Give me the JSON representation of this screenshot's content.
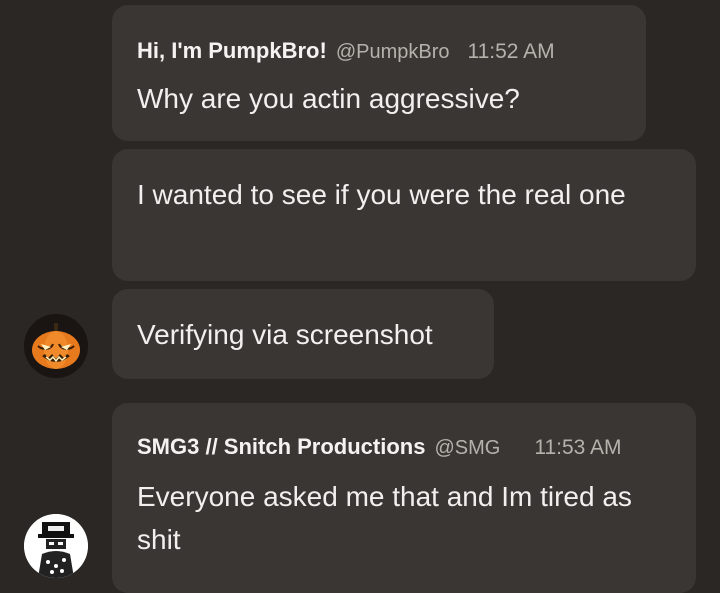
{
  "messages": [
    {
      "author": "Hi, I'm PumpkBro!",
      "handle": "@PumpkBro",
      "time": "11:52 AM",
      "text": "Why are you actin aggressive?"
    },
    {
      "text": "I wanted to see if you were the real one"
    },
    {
      "text": "Verifying via screenshot"
    },
    {
      "author": "SMG3 // Snitch Productions",
      "handle": "@SMG",
      "time": "11:53 AM",
      "text": "Everyone asked me that and Im tired as shit"
    }
  ],
  "avatars": [
    {
      "icon": "pumpkin-avatar-icon",
      "color": "#e87a1e"
    },
    {
      "icon": "smg3-avatar-icon",
      "color": "#ffffff"
    }
  ],
  "colors": {
    "background": "#2b2725",
    "bubble": "#3a3633",
    "text": "#f2f0ee",
    "meta": "#b7b1ac"
  }
}
